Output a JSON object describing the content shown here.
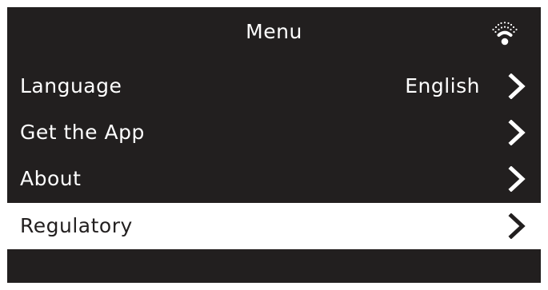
{
  "menu": {
    "title": "Menu",
    "status_icon": "wifi-icon",
    "items": [
      {
        "label": "Language",
        "value": "English",
        "icon": "chevron-right-icon",
        "selected": false
      },
      {
        "label": "Get the App",
        "value": "",
        "icon": "chevron-right-icon",
        "selected": false
      },
      {
        "label": "About",
        "value": "",
        "icon": "chevron-right-icon",
        "selected": false
      },
      {
        "label": "Regulatory",
        "value": "",
        "icon": "chevron-right-icon",
        "selected": true
      }
    ]
  },
  "colors": {
    "background": "#221f1f",
    "foreground": "#ffffff",
    "selected_background": "#ffffff",
    "selected_foreground": "#221f1f"
  }
}
